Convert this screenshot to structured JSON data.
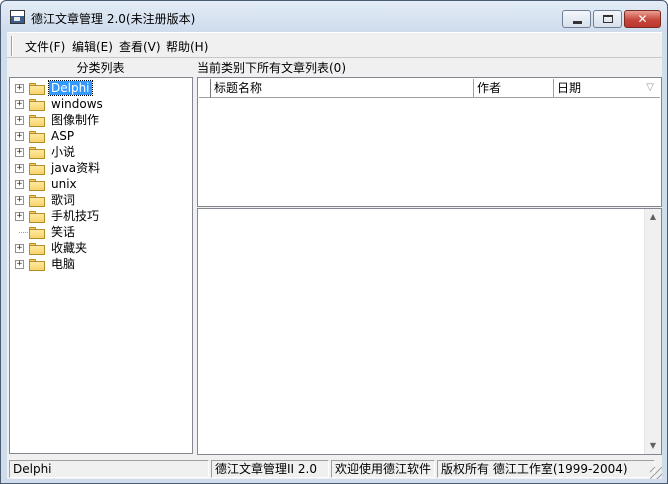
{
  "window": {
    "title": "德江文章管理 2.0(未注册版本)",
    "icon": "app-icon"
  },
  "menubar": {
    "items": [
      {
        "label": "文件(F)"
      },
      {
        "label": "编辑(E)"
      },
      {
        "label": "查看(V)"
      },
      {
        "label": "帮助(H)"
      }
    ]
  },
  "left_panel": {
    "header": "分类列表",
    "tree": [
      {
        "label": "Delphi",
        "expander": "+",
        "selected": true
      },
      {
        "label": "windows",
        "expander": "+"
      },
      {
        "label": "图像制作",
        "expander": "+"
      },
      {
        "label": "ASP",
        "expander": "+"
      },
      {
        "label": "小说",
        "expander": "+"
      },
      {
        "label": "java资料",
        "expander": "+"
      },
      {
        "label": "unix",
        "expander": "+"
      },
      {
        "label": "歌词",
        "expander": "+"
      },
      {
        "label": "手机技巧",
        "expander": "+"
      },
      {
        "label": "笑话",
        "expander": ""
      },
      {
        "label": "收藏夹",
        "expander": "+"
      },
      {
        "label": "电脑",
        "expander": "+"
      }
    ]
  },
  "right_panel": {
    "header": "当前类别下所有文章列表(0)",
    "columns": {
      "title": "标题名称",
      "author": "作者",
      "date": "日期"
    },
    "sort_indicator": "▽",
    "rows": []
  },
  "statusbar": {
    "panels": [
      "Delphi",
      "德江文章管理II 2.0",
      "欢迎使用德江软件",
      "版权所有 德江工作室(1999-2004)"
    ]
  },
  "colors": {
    "selection": "#3399ff",
    "title_bar": "#cfdcec",
    "close_button": "#c7463a",
    "folder": "#f5d36a"
  }
}
